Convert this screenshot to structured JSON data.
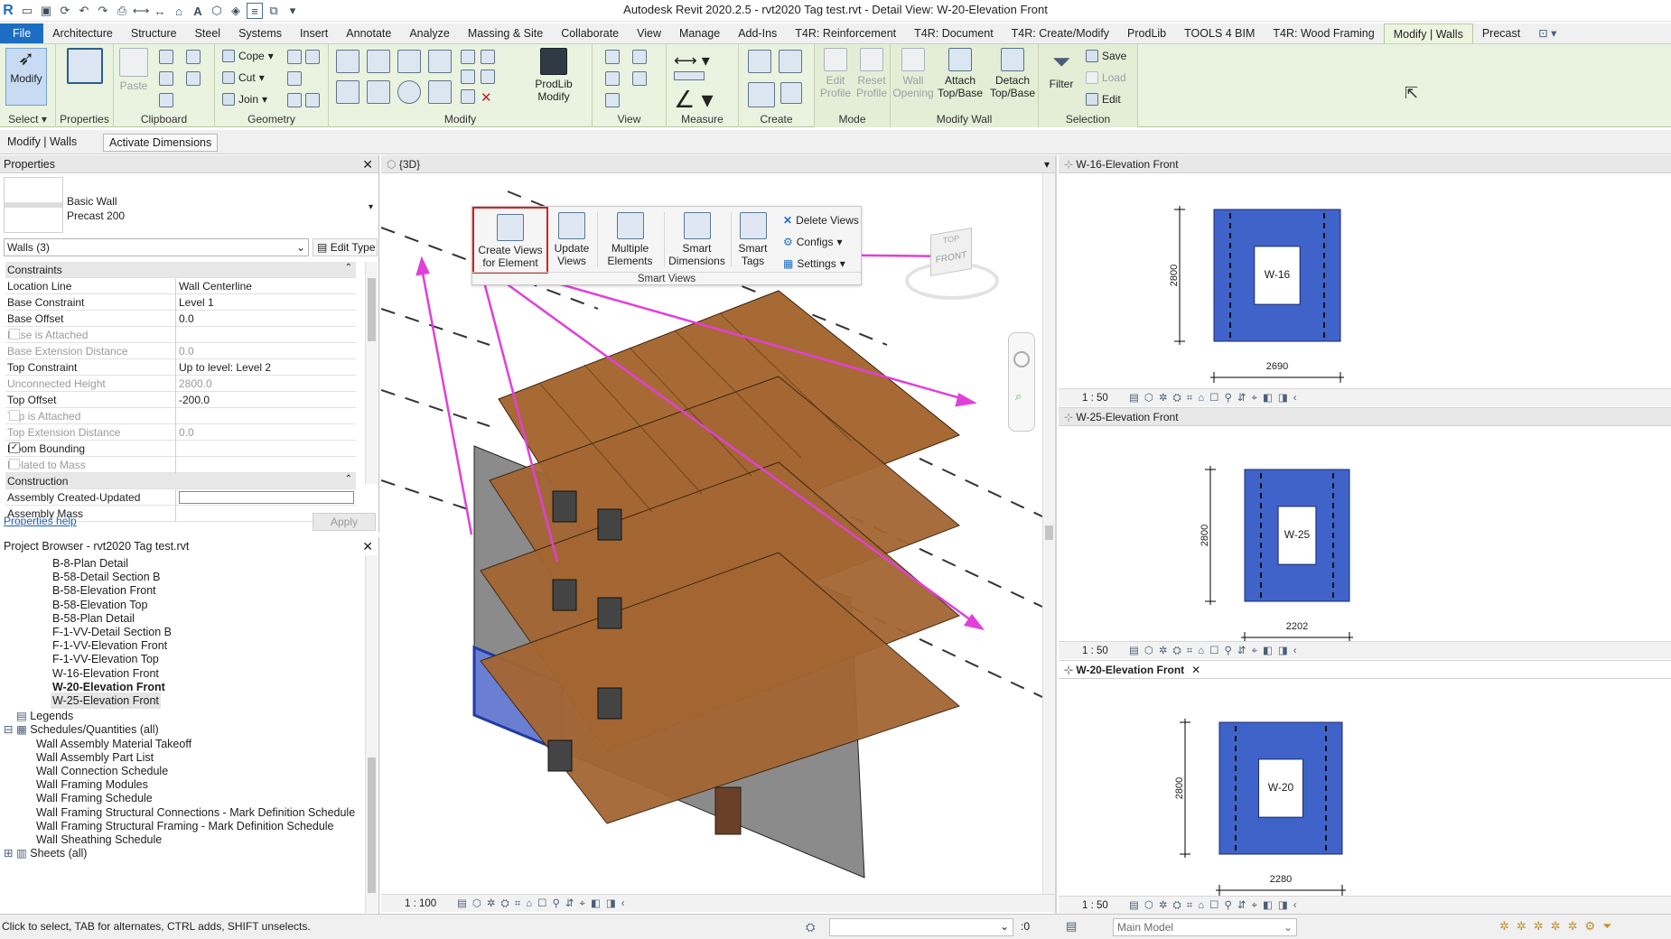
{
  "window": {
    "title": "Autodesk Revit 2020.2.5 - rvt2020 Tag test.rvt - Detail View: W-20-Elevation Front"
  },
  "tabs": [
    "File",
    "Architecture",
    "Structure",
    "Steel",
    "Systems",
    "Insert",
    "Annotate",
    "Analyze",
    "Massing & Site",
    "Collaborate",
    "View",
    "Manage",
    "Add-Ins",
    "T4R: Reinforcement",
    "T4R: Document",
    "T4R: Create/Modify",
    "ProdLib",
    "TOOLS 4 BIM",
    "T4R: Wood Framing",
    "Modify | Walls",
    "Precast"
  ],
  "active_tab": "Modify | Walls",
  "ribbon": {
    "select": {
      "modify": "Modify",
      "label": "Select"
    },
    "properties": {
      "label": "Properties"
    },
    "clipboard": {
      "paste": "Paste",
      "label": "Clipboard"
    },
    "geometry": {
      "cope": "Cope",
      "cut": "Cut",
      "join": "Join",
      "label": "Geometry"
    },
    "modify": {
      "prodlib": "ProdLib Modify",
      "label": "Modify"
    },
    "view": {
      "label": "View"
    },
    "measure": {
      "label": "Measure"
    },
    "create": {
      "label": "Create"
    },
    "mode": {
      "edit_profile": "Edit Profile",
      "reset_profile": "Reset Profile",
      "label": "Mode"
    },
    "modify_wall": {
      "wall_opening": "Wall Opening",
      "attach": "Attach Top/Base",
      "detach": "Detach Top/Base",
      "label": "Modify Wall"
    },
    "filter": {
      "label": "Filter"
    },
    "selection": {
      "save": "Save",
      "load": "Load",
      "edit": "Edit",
      "label": "Selection"
    }
  },
  "options_bar": {
    "context": "Modify | Walls",
    "activate_dimensions": "Activate Dimensions"
  },
  "properties_panel": {
    "title": "Properties",
    "type_family": "Basic Wall",
    "type_name": "Precast 200",
    "selector": "Walls (3)",
    "edit_type": "Edit Type",
    "groups": [
      {
        "name": "Constraints",
        "rows": [
          {
            "k": "Location Line",
            "v": "Wall Centerline",
            "dis": false
          },
          {
            "k": "Base Constraint",
            "v": "Level 1",
            "dis": false
          },
          {
            "k": "Base Offset",
            "v": "0.0",
            "dis": false
          },
          {
            "k": "Base is Attached",
            "v": "",
            "cb": "off",
            "dis": true
          },
          {
            "k": "Base Extension Distance",
            "v": "0.0",
            "dis": true
          },
          {
            "k": "Top Constraint",
            "v": "Up to level: Level 2",
            "dis": false
          },
          {
            "k": "Unconnected Height",
            "v": "2800.0",
            "dis": true
          },
          {
            "k": "Top Offset",
            "v": "-200.0",
            "dis": false
          },
          {
            "k": "Top is Attached",
            "v": "",
            "cb": "off",
            "dis": true
          },
          {
            "k": "Top Extension Distance",
            "v": "0.0",
            "dis": true
          },
          {
            "k": "Room Bounding",
            "v": "",
            "cb": "on",
            "dis": false
          },
          {
            "k": "Related to Mass",
            "v": "",
            "cb": "off",
            "dis": true
          }
        ]
      },
      {
        "name": "Construction",
        "rows": [
          {
            "k": "Assembly Created-Updated",
            "v": "",
            "dis": false
          },
          {
            "k": "Assembly Mass",
            "v": "",
            "dis": false
          }
        ]
      }
    ],
    "help": "Properties help",
    "apply": "Apply"
  },
  "project_browser": {
    "title": "Project Browser - rvt2020 Tag test.rvt",
    "views": [
      {
        "t": "B-8-Plan Detail"
      },
      {
        "t": "B-58-Detail Section B"
      },
      {
        "t": "B-58-Elevation Front"
      },
      {
        "t": "B-58-Elevation Top"
      },
      {
        "t": "B-58-Plan Detail"
      },
      {
        "t": "F-1-VV-Detail Section B"
      },
      {
        "t": "F-1-VV-Elevation Front"
      },
      {
        "t": "F-1-VV-Elevation Top"
      },
      {
        "t": "W-16-Elevation Front"
      },
      {
        "t": "W-20-Elevation Front",
        "bold": true
      },
      {
        "t": "W-25-Elevation Front",
        "sel": true
      }
    ],
    "legends": "Legends",
    "schedules": "Schedules/Quantities (all)",
    "schedule_items": [
      "Wall Assembly Material Takeoff",
      "Wall Assembly Part List",
      "Wall Connection Schedule",
      "Wall Framing Modules",
      "Wall Framing Schedule",
      "Wall Framing Structural Connections - Mark  Definition Schedule",
      "Wall Framing Structural Framing - Mark  Definition Schedule",
      "Wall Sheathing Schedule"
    ],
    "sheets": "Sheets (all)"
  },
  "view3d": {
    "title": "{3D}",
    "scale": "1 : 100"
  },
  "smart_views": {
    "create_views": "Create Views for Element",
    "update_views": "Update Views",
    "multiple": "Multiple Elements",
    "smart_dimensions": "Smart Dimensions",
    "smart_tags": "Smart Tags",
    "delete_views": "Delete Views",
    "configs": "Configs",
    "settings": "Settings",
    "panel_label": "Smart Views"
  },
  "viewcube": {
    "top": "TOP",
    "front": "FRONT"
  },
  "elevations": [
    {
      "title": "W-16-Elevation Front",
      "tag": "W-16",
      "height_dim": "2800",
      "width_dim": "2690",
      "scale": "1 : 50",
      "active": false
    },
    {
      "title": "W-25-Elevation Front",
      "tag": "W-25",
      "height_dim": "2800",
      "width_dim": "2202",
      "scale": "1 : 50",
      "active": false
    },
    {
      "title": "W-20-Elevation Front",
      "tag": "W-20",
      "height_dim": "2800",
      "width_dim": "2280",
      "scale": "1 : 50",
      "active": true
    }
  ],
  "statusbar": {
    "hint": "Click to select, TAB for alternates, CTRL adds, SHIFT unselects.",
    "coord": ":0",
    "model": "Main Model"
  },
  "colors": {
    "wall_blue": "#3f63c8",
    "arrow": "#e040d8",
    "highlight": "#d42020",
    "ribbon_bg": "#eaf3df",
    "file_tab": "#1b6ec2"
  }
}
